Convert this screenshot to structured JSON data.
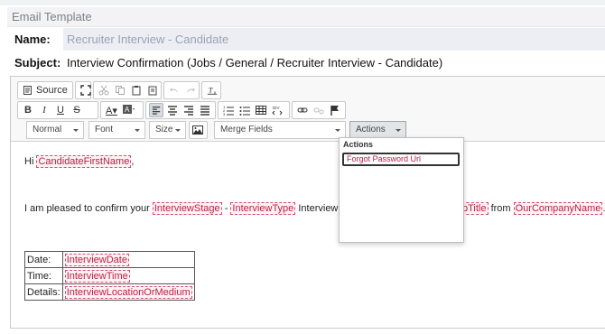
{
  "section": {
    "title": "Email Template"
  },
  "name": {
    "label": "Name:",
    "value": "Recruiter Interview - Candidate"
  },
  "subject": {
    "label": "Subject:",
    "value": "Interview Confirmation (Jobs / General / Recruiter Interview - Candidate)"
  },
  "toolbar": {
    "source_label": "Source",
    "combos": {
      "format": "Normal",
      "font": "Font",
      "size": "Size",
      "merge": "Merge Fields",
      "actions": "Actions"
    }
  },
  "body": {
    "greeting": "Hi",
    "first_name_tag": "CandidateFirstName",
    "comma": ",",
    "p2_start": "I am pleased to confirm your",
    "stage_tag": "InterviewStage",
    "dash": "-",
    "type_tag": "InterviewType",
    "with_text": "Interview with",
    "job_tag_partial": "bTitle",
    "from_text": "from",
    "company_tag": "OurCompanyName",
    "dot": "."
  },
  "table": {
    "rows": [
      {
        "label": "Date:",
        "tag": "InterviewDate"
      },
      {
        "label": "Time:",
        "tag": "InterviewTime"
      },
      {
        "label": "Details:",
        "tag": "InterviewLocationOrMedium"
      }
    ]
  },
  "actions_menu": {
    "title": "Actions",
    "items": [
      "Forgot Password Url"
    ]
  },
  "colors": {
    "placeholder_text": "#c11a3f",
    "placeholder_border": "#d84a6a",
    "header_bg": "#f3f3f5"
  }
}
